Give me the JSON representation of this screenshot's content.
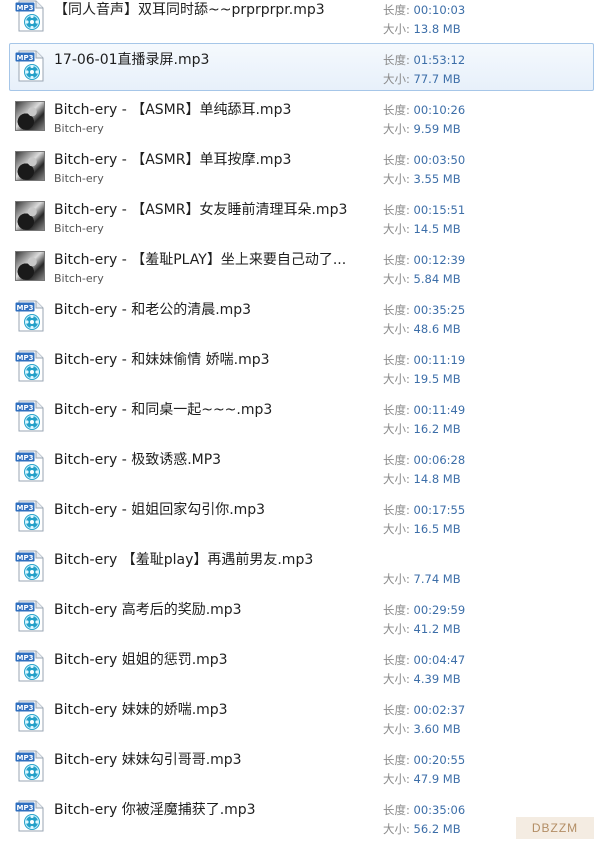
{
  "labels": {
    "length": "长度:",
    "size": "大小:"
  },
  "files": [
    {
      "name": "【同人音声】双耳同时舔~~prprprpr.mp3",
      "artist": "",
      "length": "00:10:03",
      "size": "13.8 MB",
      "icon": "mp3-file-icon",
      "selected": false
    },
    {
      "name": "17-06-01直播录屏.mp3",
      "artist": "",
      "length": "01:53:12",
      "size": "77.7 MB",
      "icon": "mp3-file-icon",
      "selected": true
    },
    {
      "name": "Bitch-ery - 【ASMR】单纯舔耳.mp3",
      "artist": "Bitch-ery",
      "length": "00:10:26",
      "size": "9.59 MB",
      "icon": "album-art-thumbnail",
      "selected": false
    },
    {
      "name": "Bitch-ery - 【ASMR】单耳按摩.mp3",
      "artist": "Bitch-ery",
      "length": "00:03:50",
      "size": "3.55 MB",
      "icon": "album-art-thumbnail",
      "selected": false
    },
    {
      "name": "Bitch-ery - 【ASMR】女友睡前清理耳朵.mp3",
      "artist": "Bitch-ery",
      "length": "00:15:51",
      "size": "14.5 MB",
      "icon": "album-art-thumbnail",
      "selected": false
    },
    {
      "name": "Bitch-ery - 【羞耻PLAY】坐上来要自己动了...",
      "artist": "Bitch-ery",
      "length": "00:12:39",
      "size": "5.84 MB",
      "icon": "album-art-thumbnail",
      "selected": false
    },
    {
      "name": "Bitch-ery - 和老公的清晨.mp3",
      "artist": "",
      "length": "00:35:25",
      "size": "48.6 MB",
      "icon": "mp3-file-icon",
      "selected": false
    },
    {
      "name": "Bitch-ery - 和妹妹偷情 娇喘.mp3",
      "artist": "",
      "length": "00:11:19",
      "size": "19.5 MB",
      "icon": "mp3-file-icon",
      "selected": false
    },
    {
      "name": "Bitch-ery - 和同桌一起~~~.mp3",
      "artist": "",
      "length": "00:11:49",
      "size": "16.2 MB",
      "icon": "mp3-file-icon",
      "selected": false
    },
    {
      "name": "Bitch-ery - 极致诱惑.MP3",
      "artist": "",
      "length": "00:06:28",
      "size": "14.8 MB",
      "icon": "mp3-file-icon",
      "selected": false
    },
    {
      "name": "Bitch-ery - 姐姐回家勾引你.mp3",
      "artist": "",
      "length": "00:17:55",
      "size": "16.5 MB",
      "icon": "mp3-file-icon",
      "selected": false
    },
    {
      "name": "Bitch-ery 【羞耻play】再遇前男友.mp3",
      "artist": "",
      "length": "",
      "size": "7.74 MB",
      "icon": "mp3-file-icon",
      "selected": false
    },
    {
      "name": "Bitch-ery 高考后的奖励.mp3",
      "artist": "",
      "length": "00:29:59",
      "size": "41.2 MB",
      "icon": "mp3-file-icon",
      "selected": false
    },
    {
      "name": "Bitch-ery 姐姐的惩罚.mp3",
      "artist": "",
      "length": "00:04:47",
      "size": "4.39 MB",
      "icon": "mp3-file-icon",
      "selected": false
    },
    {
      "name": "Bitch-ery 妹妹的娇喘.mp3",
      "artist": "",
      "length": "00:02:37",
      "size": "3.60 MB",
      "icon": "mp3-file-icon",
      "selected": false
    },
    {
      "name": "Bitch-ery 妹妹勾引哥哥.mp3",
      "artist": "",
      "length": "00:20:55",
      "size": "47.9 MB",
      "icon": "mp3-file-icon",
      "selected": false
    },
    {
      "name": "Bitch-ery 你被淫魔捕获了.mp3",
      "artist": "",
      "length": "00:35:06",
      "size": "56.2 MB",
      "icon": "mp3-file-icon",
      "selected": false
    }
  ],
  "watermark": "DBZZM"
}
